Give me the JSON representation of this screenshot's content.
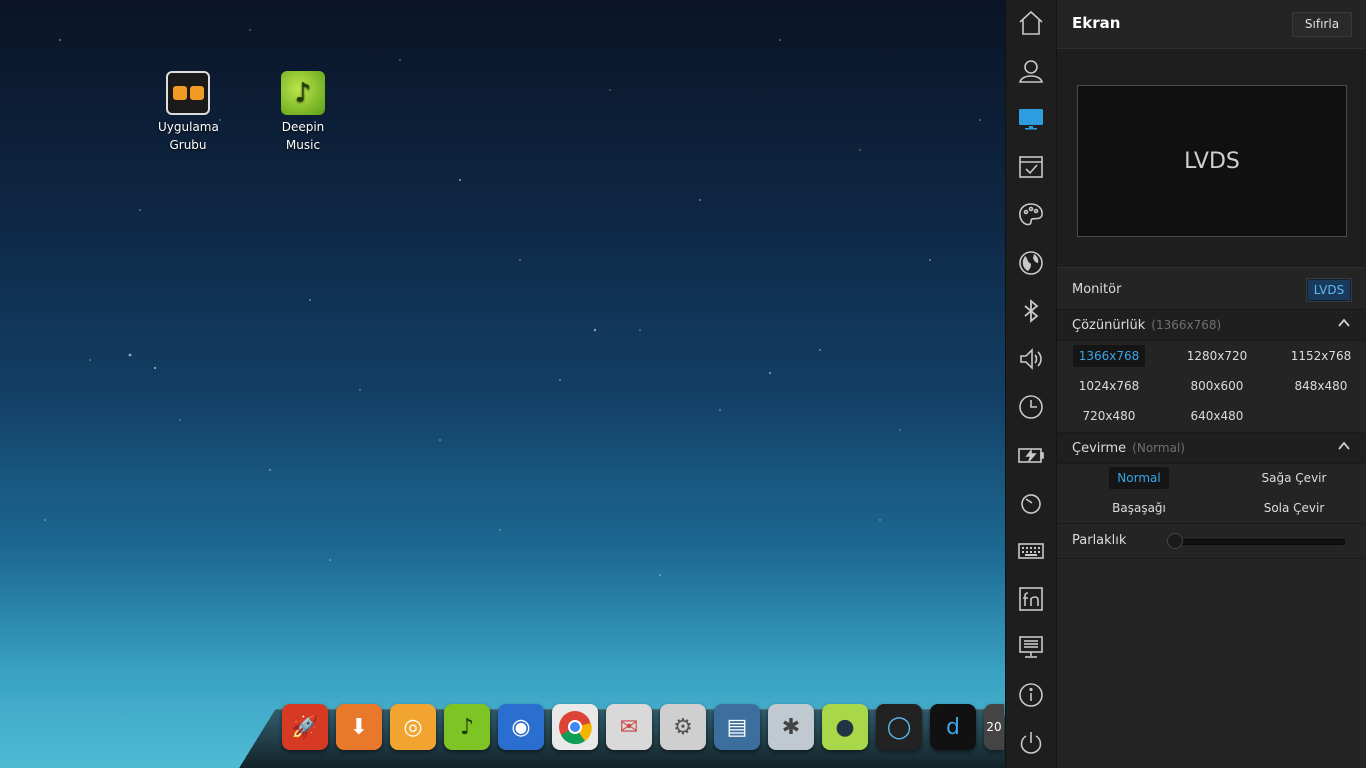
{
  "desktop": {
    "icons": [
      {
        "label": "Uygulama Grubu"
      },
      {
        "label": "Deepin Music"
      }
    ]
  },
  "dock": {
    "items": [
      {
        "icon": "rocket-launcher-icon",
        "color": "#d63a22"
      },
      {
        "icon": "software-center-icon",
        "color": "#e8782a"
      },
      {
        "icon": "deepin-game-icon",
        "color": "#f1a530"
      },
      {
        "icon": "deepin-music-icon",
        "color": "#7dc425"
      },
      {
        "icon": "browser-globe-icon",
        "color": "#2a6fd0"
      },
      {
        "icon": "chrome-icon",
        "color": "#e9e9e9"
      },
      {
        "icon": "file-manager-icon",
        "color": "#d9d9d9"
      },
      {
        "icon": "settings-gear-icon",
        "color": "#cfcfcf"
      },
      {
        "icon": "document-viewer-icon",
        "color": "#3c6f9e"
      },
      {
        "icon": "system-settings-icon",
        "color": "#c0c8d0"
      },
      {
        "icon": "deepin-movie-icon",
        "color": "#a8d84a"
      },
      {
        "icon": "media-player-icon",
        "color": "#222"
      },
      {
        "icon": "deepin-d-icon",
        "color": "#111"
      },
      {
        "icon": "clock-icon",
        "color": "#444"
      }
    ],
    "clock_partial": "20"
  },
  "panel": {
    "title": "Ekran",
    "reset_label": "Sıfırla",
    "preview_label": "LVDS",
    "monitor": {
      "label": "Monitör",
      "value": "LVDS"
    },
    "resolution": {
      "label": "Çözünürlük",
      "current": "(1366x768)",
      "options": [
        "1366x768",
        "1280x720",
        "1152x768",
        "1024x768",
        "800x600",
        "848x480",
        "720x480",
        "640x480"
      ],
      "selected": "1366x768"
    },
    "rotation": {
      "label": "Çevirme",
      "current": "(Normal)",
      "options": [
        "Normal",
        "Sağa Çevir",
        "Başaşağı",
        "Sola Çevir"
      ],
      "selected": "Normal"
    },
    "brightness": {
      "label": "Parlaklık",
      "level": 0.0
    }
  },
  "sidebar": {
    "items": [
      {
        "icon": "home-icon"
      },
      {
        "icon": "user-accounts-icon"
      },
      {
        "icon": "display-icon",
        "active": true
      },
      {
        "icon": "default-apps-icon"
      },
      {
        "icon": "personalization-icon"
      },
      {
        "icon": "network-globe-icon"
      },
      {
        "icon": "bluetooth-icon"
      },
      {
        "icon": "sound-icon"
      },
      {
        "icon": "date-time-icon"
      },
      {
        "icon": "power-icon"
      },
      {
        "icon": "mouse-icon"
      },
      {
        "icon": "keyboard-icon"
      },
      {
        "icon": "shortcuts-fn-icon"
      },
      {
        "icon": "system-info-icon"
      },
      {
        "icon": "about-icon"
      },
      {
        "icon": "shutdown-icon"
      }
    ]
  },
  "colors": {
    "accent": "#3aa6ea",
    "panel_bg": "#242424",
    "sidebar_bg": "#1e1e1e"
  }
}
